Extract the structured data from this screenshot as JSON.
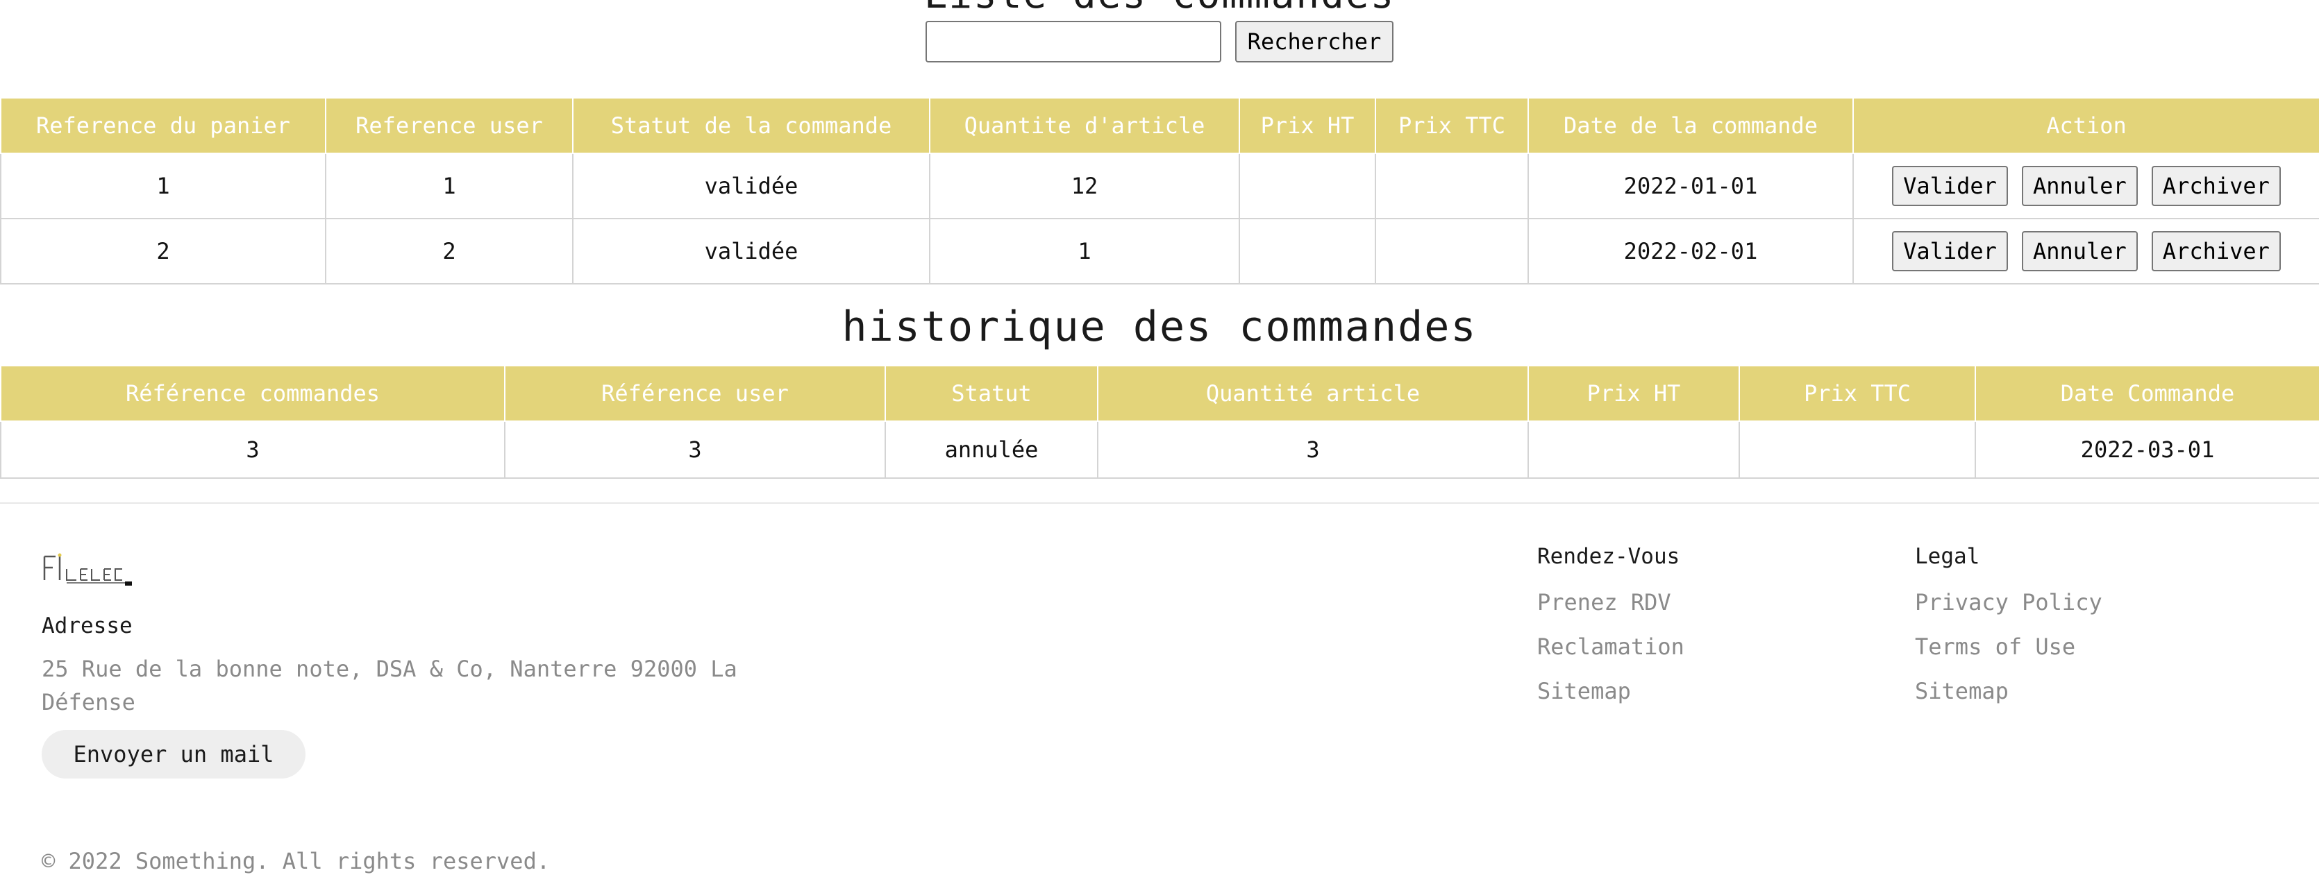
{
  "page_title": "Liste des commandes",
  "search": {
    "placeholder": "",
    "value": "",
    "button_label": "Rechercher"
  },
  "cart_table": {
    "headers": [
      "Reference du panier",
      "Reference user",
      "Statut de la commande",
      "Quantite d'article",
      "Prix HT",
      "Prix TTC",
      "Date de la commande",
      "Action"
    ],
    "rows": [
      {
        "ref_panier": "1",
        "ref_user": "1",
        "statut": "validée",
        "quantite": "12",
        "prix_ht": "",
        "prix_ttc": "",
        "date": "2022-01-01"
      },
      {
        "ref_panier": "2",
        "ref_user": "2",
        "statut": "validée",
        "quantite": "1",
        "prix_ht": "",
        "prix_ttc": "",
        "date": "2022-02-01"
      }
    ],
    "actions": {
      "validate": "Valider",
      "cancel": "Annuler",
      "archive": "Archiver"
    }
  },
  "history": {
    "title": "historique des commandes",
    "headers": [
      "Référence commandes",
      "Référence user",
      "Statut",
      "Quantité article",
      "Prix HT",
      "Prix TTC",
      "Date Commande"
    ],
    "rows": [
      {
        "ref_commande": "3",
        "ref_user": "3",
        "statut": "annulée",
        "quantite": "3",
        "prix_ht": "",
        "prix_ttc": "",
        "date": "2022-03-01"
      }
    ]
  },
  "footer": {
    "logo_text": "FILELEC",
    "address_title": "Adresse",
    "address_text": "25 Rue de la bonne note, DSA & Co, Nanterre 92000 La Défense",
    "mail_button": "Envoyer un mail",
    "columns": [
      {
        "title": "Rendez-Vous",
        "links": [
          "Prenez RDV",
          "Reclamation",
          "Sitemap"
        ]
      },
      {
        "title": "Legal",
        "links": [
          "Privacy Policy",
          "Terms of Use",
          "Sitemap"
        ]
      }
    ],
    "copyright": "© 2022 Something. All rights reserved."
  },
  "colors": {
    "header_bg": "#e3d47a",
    "header_text": "#ffffff",
    "muted_text": "#8a8a8a"
  }
}
